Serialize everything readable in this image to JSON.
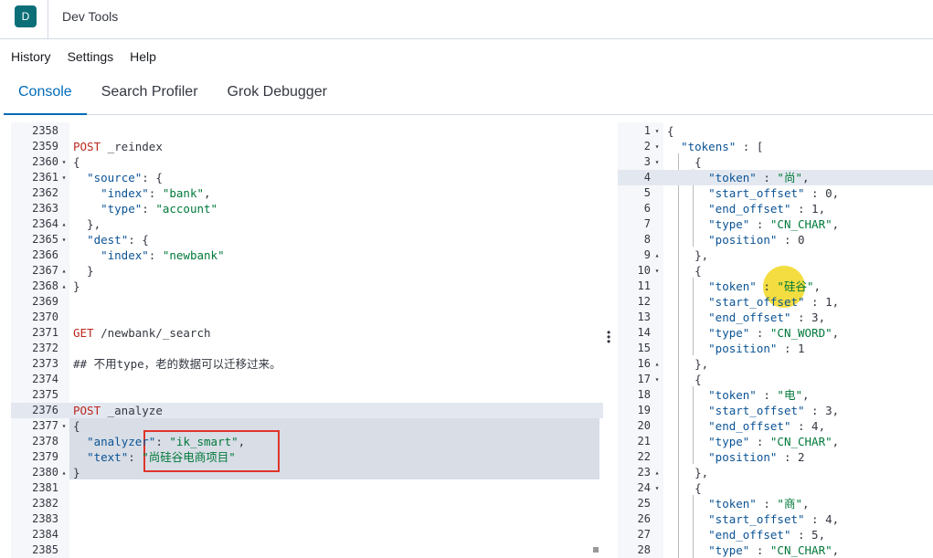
{
  "app": {
    "logo_letter": "D",
    "title": "Dev Tools"
  },
  "menu": [
    "History",
    "Settings",
    "Help"
  ],
  "tabs": [
    {
      "label": "Console",
      "active": true
    },
    {
      "label": "Search Profiler",
      "active": false
    },
    {
      "label": "Grok Debugger",
      "active": false
    }
  ],
  "editor": {
    "lines": [
      {
        "n": "2358",
        "fold": "",
        "code": ""
      },
      {
        "n": "2359",
        "fold": "",
        "code": "POST _reindex"
      },
      {
        "n": "2360",
        "fold": "▾",
        "code": "{"
      },
      {
        "n": "2361",
        "fold": "▾",
        "code": "  \"source\": {"
      },
      {
        "n": "2362",
        "fold": "",
        "code": "    \"index\": \"bank\","
      },
      {
        "n": "2363",
        "fold": "",
        "code": "    \"type\": \"account\""
      },
      {
        "n": "2364",
        "fold": "▴",
        "code": "  },"
      },
      {
        "n": "2365",
        "fold": "▾",
        "code": "  \"dest\": {"
      },
      {
        "n": "2366",
        "fold": "",
        "code": "    \"index\": \"newbank\""
      },
      {
        "n": "2367",
        "fold": "▴",
        "code": "  }"
      },
      {
        "n": "2368",
        "fold": "▴",
        "code": "}"
      },
      {
        "n": "2369",
        "fold": "",
        "code": ""
      },
      {
        "n": "2370",
        "fold": "",
        "code": ""
      },
      {
        "n": "2371",
        "fold": "",
        "code": "GET /newbank/_search"
      },
      {
        "n": "2372",
        "fold": "",
        "code": ""
      },
      {
        "n": "2373",
        "fold": "",
        "code": "## 不用type，老的数据可以迁移过来。"
      },
      {
        "n": "2374",
        "fold": "",
        "code": ""
      },
      {
        "n": "2375",
        "fold": "",
        "code": ""
      },
      {
        "n": "2376",
        "fold": "",
        "code": "POST _analyze"
      },
      {
        "n": "2377",
        "fold": "▾",
        "code": "{"
      },
      {
        "n": "2378",
        "fold": "",
        "code": "  \"analyzer\": \"ik_smart\","
      },
      {
        "n": "2379",
        "fold": "",
        "code": "  \"text\": \"尚硅谷电商项目\""
      },
      {
        "n": "2380",
        "fold": "▴",
        "code": "}"
      },
      {
        "n": "2381",
        "fold": "",
        "code": ""
      },
      {
        "n": "2382",
        "fold": "",
        "code": ""
      },
      {
        "n": "2383",
        "fold": "",
        "code": ""
      },
      {
        "n": "2384",
        "fold": "",
        "code": ""
      },
      {
        "n": "2385",
        "fold": "",
        "code": ""
      }
    ]
  },
  "output": {
    "lines": [
      {
        "n": "1",
        "fold": "▾",
        "code": "{"
      },
      {
        "n": "2",
        "fold": "▾",
        "code": "  \"tokens\" : ["
      },
      {
        "n": "3",
        "fold": "▾",
        "code": "    {"
      },
      {
        "n": "4",
        "fold": "",
        "code": "      \"token\" : \"尚\","
      },
      {
        "n": "5",
        "fold": "",
        "code": "      \"start_offset\" : 0,"
      },
      {
        "n": "6",
        "fold": "",
        "code": "      \"end_offset\" : 1,"
      },
      {
        "n": "7",
        "fold": "",
        "code": "      \"type\" : \"CN_CHAR\","
      },
      {
        "n": "8",
        "fold": "",
        "code": "      \"position\" : 0"
      },
      {
        "n": "9",
        "fold": "▴",
        "code": "    },"
      },
      {
        "n": "10",
        "fold": "▾",
        "code": "    {"
      },
      {
        "n": "11",
        "fold": "",
        "code": "      \"token\" : \"硅谷\","
      },
      {
        "n": "12",
        "fold": "",
        "code": "      \"start_offset\" : 1,"
      },
      {
        "n": "13",
        "fold": "",
        "code": "      \"end_offset\" : 3,"
      },
      {
        "n": "14",
        "fold": "",
        "code": "      \"type\" : \"CN_WORD\","
      },
      {
        "n": "15",
        "fold": "",
        "code": "      \"position\" : 1"
      },
      {
        "n": "16",
        "fold": "▴",
        "code": "    },"
      },
      {
        "n": "17",
        "fold": "▾",
        "code": "    {"
      },
      {
        "n": "18",
        "fold": "",
        "code": "      \"token\" : \"电\","
      },
      {
        "n": "19",
        "fold": "",
        "code": "      \"start_offset\" : 3,"
      },
      {
        "n": "20",
        "fold": "",
        "code": "      \"end_offset\" : 4,"
      },
      {
        "n": "21",
        "fold": "",
        "code": "      \"type\" : \"CN_CHAR\","
      },
      {
        "n": "22",
        "fold": "",
        "code": "      \"position\" : 2"
      },
      {
        "n": "23",
        "fold": "▴",
        "code": "    },"
      },
      {
        "n": "24",
        "fold": "▾",
        "code": "    {"
      },
      {
        "n": "25",
        "fold": "",
        "code": "      \"token\" : \"商\","
      },
      {
        "n": "26",
        "fold": "",
        "code": "      \"start_offset\" : 4,"
      },
      {
        "n": "27",
        "fold": "",
        "code": "      \"end_offset\" : 5,"
      },
      {
        "n": "28",
        "fold": "",
        "code": "      \"type\" : \"CN_CHAR\","
      }
    ]
  },
  "icons": {
    "play": "play-icon",
    "wrench": "wrench-icon",
    "splitter": "vertical-ellipsis-icon"
  },
  "colors": {
    "accent": "#006bb8",
    "logo": "#0b6f77",
    "highlight": "#e0352b"
  }
}
